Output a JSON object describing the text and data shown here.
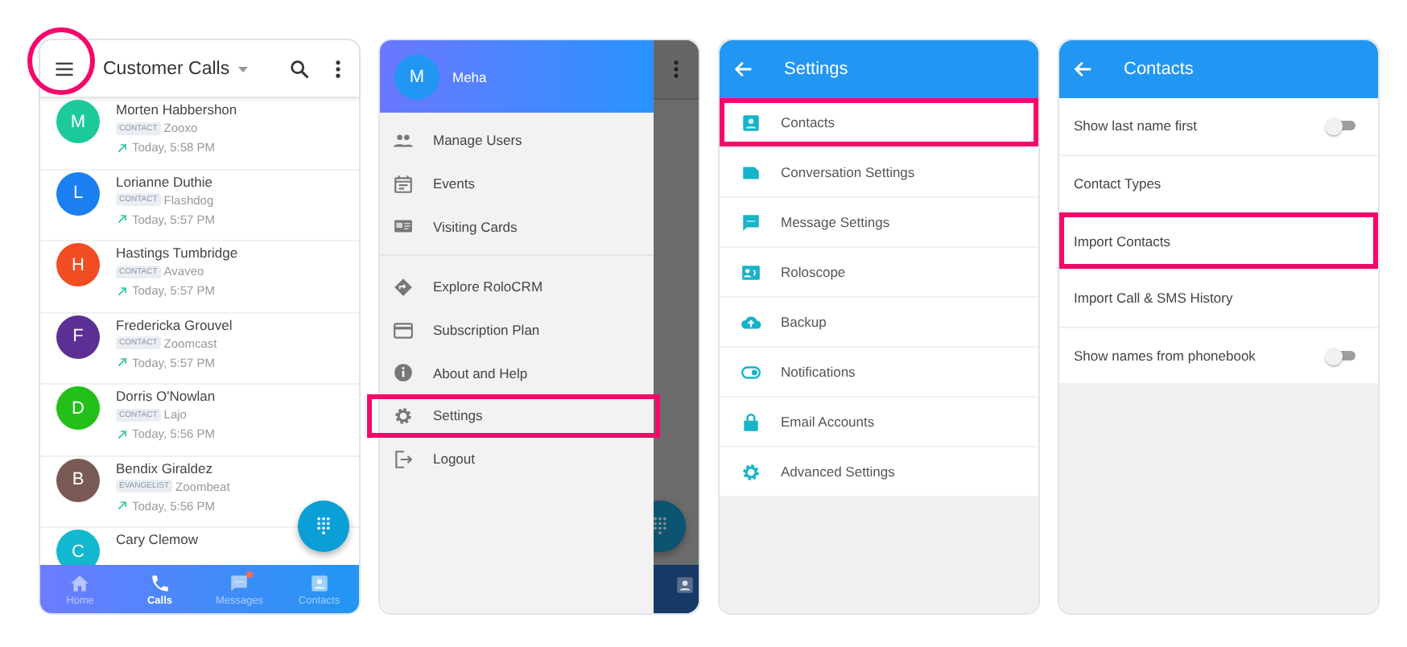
{
  "calls_screen": {
    "title": "Customer Calls",
    "menu_highlighted": true,
    "calls": [
      {
        "initial": "M",
        "color": "#1dc99b",
        "name": "Morten Habbershon",
        "tag": "CONTACT",
        "company": "Zooxo",
        "time": "Today, 5:58 PM"
      },
      {
        "initial": "L",
        "color": "#1a7ff0",
        "name": "Lorianne Duthie",
        "tag": "CONTACT",
        "company": "Flashdog",
        "time": "Today, 5:57 PM"
      },
      {
        "initial": "H",
        "color": "#f04d22",
        "name": "Hastings Tumbridge",
        "tag": "CONTACT",
        "company": "Avaveo",
        "time": "Today, 5:57 PM"
      },
      {
        "initial": "F",
        "color": "#5c2f94",
        "name": "Fredericka Grouvel",
        "tag": "CONTACT",
        "company": "Zoomcast",
        "time": "Today, 5:57 PM"
      },
      {
        "initial": "D",
        "color": "#23c019",
        "name": "Dorris O'Nowlan",
        "tag": "CONTACT",
        "company": "Lajo",
        "time": "Today, 5:56 PM"
      },
      {
        "initial": "B",
        "color": "#7a5a55",
        "name": "Bendix Giraldez",
        "tag": "EVANGELIST",
        "company": "Zoombeat",
        "time": "Today, 5:56 PM"
      },
      {
        "initial": "C",
        "color": "#12b8d0",
        "name": "Cary Clemow"
      }
    ],
    "nav": [
      {
        "label": "Home",
        "selected": false,
        "unread": false
      },
      {
        "label": "Calls",
        "selected": true,
        "unread": false
      },
      {
        "label": "Messages",
        "selected": false,
        "unread": true
      },
      {
        "label": "Contacts",
        "selected": false,
        "unread": false
      }
    ]
  },
  "drawer_screen": {
    "user": {
      "initial": "M",
      "name": "Meha"
    },
    "menu_groups": [
      [
        {
          "label": "Manage Users",
          "highlighted": false
        },
        {
          "label": "Events",
          "highlighted": false
        },
        {
          "label": "Visiting Cards",
          "highlighted": false
        }
      ],
      [
        {
          "label": "Explore RoloCRM",
          "highlighted": false
        },
        {
          "label": "Subscription Plan",
          "highlighted": false
        },
        {
          "label": "About and Help",
          "highlighted": false
        },
        {
          "label": "Settings",
          "highlighted": true
        },
        {
          "label": "Logout",
          "highlighted": false
        }
      ]
    ]
  },
  "settings_screen": {
    "title": "Settings",
    "items": [
      {
        "label": "Contacts",
        "highlighted": true
      },
      {
        "label": "Conversation Settings",
        "highlighted": false
      },
      {
        "label": "Message Settings",
        "highlighted": false
      },
      {
        "label": "Roloscope",
        "highlighted": false
      },
      {
        "label": "Backup",
        "highlighted": false
      },
      {
        "label": "Notifications",
        "highlighted": false
      },
      {
        "label": "Email Accounts",
        "highlighted": false
      },
      {
        "label": "Advanced Settings",
        "highlighted": false
      }
    ]
  },
  "contacts_screen": {
    "title": "Contacts",
    "items": [
      {
        "kind": "toggle",
        "label": "Show last name first",
        "on": false,
        "highlighted": false
      },
      {
        "kind": "link",
        "label": "Contact Types",
        "highlighted": false
      },
      {
        "kind": "link",
        "label": "Import Contacts",
        "highlighted": true
      },
      {
        "kind": "link",
        "label": "Import Call & SMS History",
        "highlighted": false
      },
      {
        "kind": "toggle",
        "label": "Show names from phonebook",
        "on": false,
        "highlighted": false
      }
    ]
  }
}
